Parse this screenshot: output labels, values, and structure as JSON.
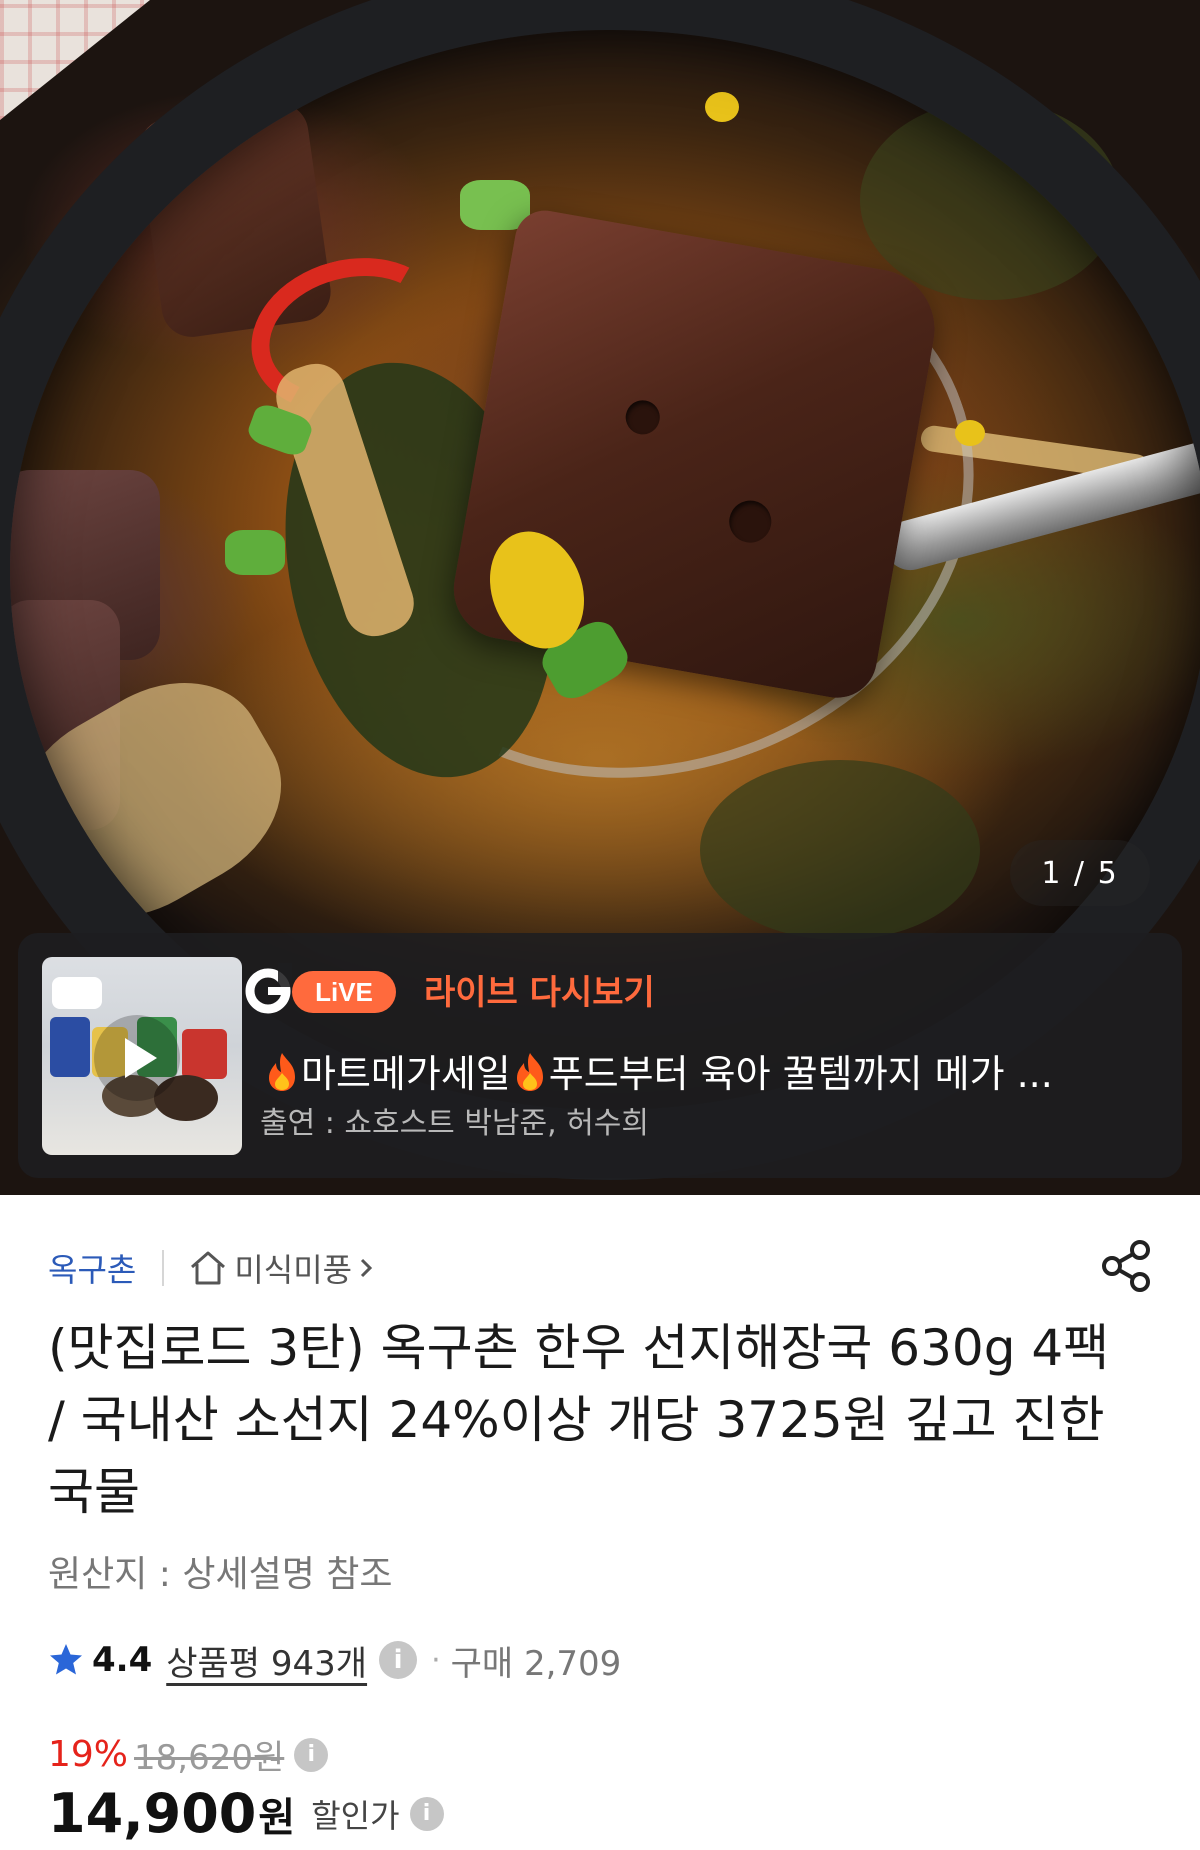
{
  "hero": {
    "counter": "1 / 5"
  },
  "live": {
    "logo_letter": "G",
    "logo_badge": "LiVE",
    "title": "라이브 다시보기",
    "subtitle_part1": "마트메가세일",
    "subtitle_part2": "푸드부터 육아 꿀템까지 메가 ...",
    "cast": "출연 : 쇼호스트 박남준, 허수희",
    "accent_color": "#ff6a3d"
  },
  "store": {
    "name": "옥구촌",
    "shop_link": "미식미풍"
  },
  "product": {
    "title": "(맛집로드 3탄) 옥구촌 한우 선지해장국 630g 4팩 / 국내산 소선지 24%이상 개당 3725원 깊고 진한 국물",
    "origin": "원산지 : 상세설명 참조",
    "rating": "4.4",
    "reviews": "상품평 943개",
    "purchase": "구매 2,709",
    "discount_rate": "19%",
    "original_price": "18,620원",
    "sale_price": "14,900",
    "currency": "원",
    "sale_label": "할인가"
  },
  "icons": {
    "star": "star-icon",
    "info": "info-icon",
    "share": "share-icon",
    "home": "home-icon",
    "play": "play-icon",
    "fire": "fire-icon"
  }
}
